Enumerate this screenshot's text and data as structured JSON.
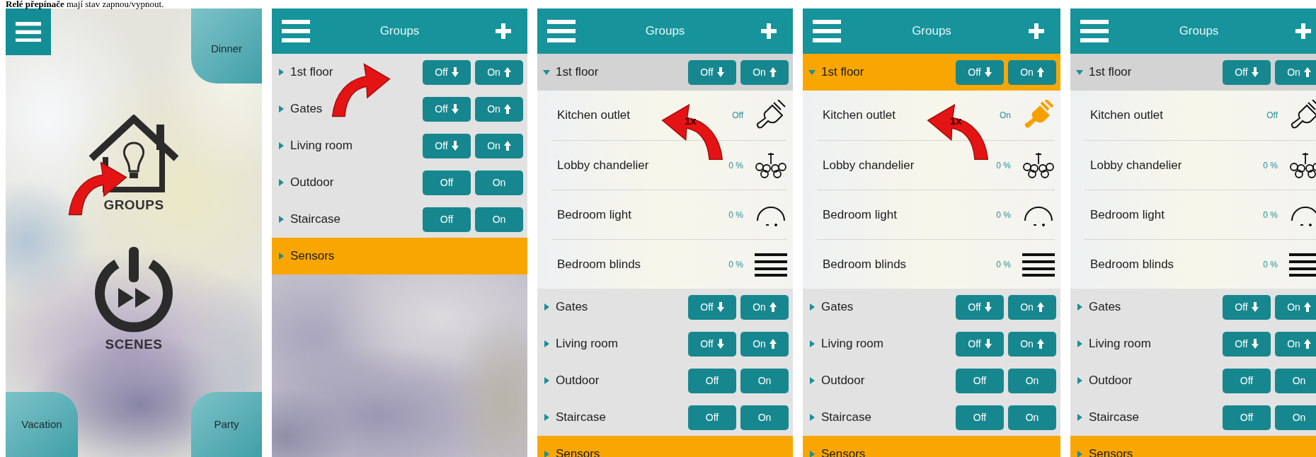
{
  "caption": "**Relé přepínače** mají stav zapnou/vypnout.",
  "home_screen": {
    "tiles": [
      {
        "label": "Dinner"
      },
      {
        "label": "Vacation"
      },
      {
        "label": "Party"
      }
    ],
    "menu_items": [
      {
        "label": "GROUPS",
        "kind": "groups"
      },
      {
        "label": "SCENES",
        "kind": "scenes"
      }
    ],
    "annotation": {
      "mirrored": false
    }
  },
  "group_screens": [
    {
      "title": "Groups",
      "annotation": {
        "mirrored": false
      },
      "groups": [
        {
          "name": "1st floor",
          "expanded": false,
          "highlighted": false,
          "buttons": [
            {
              "label": "Off",
              "with_arrow": true
            },
            {
              "label": "On",
              "with_arrow": true
            }
          ]
        },
        {
          "name": "Gates",
          "expanded": false,
          "highlighted": false,
          "buttons": [
            {
              "label": "Off",
              "with_arrow": true
            },
            {
              "label": "On",
              "with_arrow": true
            }
          ]
        },
        {
          "name": "Living room",
          "expanded": false,
          "highlighted": false,
          "buttons": [
            {
              "label": "Off",
              "with_arrow": true
            },
            {
              "label": "On",
              "with_arrow": true
            }
          ]
        },
        {
          "name": "Outdoor",
          "expanded": false,
          "highlighted": false,
          "buttons": [
            {
              "label": "Off",
              "with_arrow": false
            },
            {
              "label": "On",
              "with_arrow": false
            }
          ]
        },
        {
          "name": "Staircase",
          "expanded": false,
          "highlighted": false,
          "buttons": [
            {
              "label": "Off",
              "with_arrow": false
            },
            {
              "label": "On",
              "with_arrow": false
            }
          ]
        },
        {
          "name": "Sensors",
          "expanded": false,
          "highlighted": true
        }
      ]
    },
    {
      "title": "Groups",
      "annotation": {
        "mirrored": true,
        "text": "1x"
      },
      "groups": [
        {
          "name": "1st floor",
          "expanded": true,
          "highlighted": false,
          "buttons": [
            {
              "label": "Off",
              "with_arrow": true
            },
            {
              "label": "On",
              "with_arrow": true
            }
          ],
          "devices": [
            {
              "name": "Kitchen outlet",
              "reading": "Off",
              "kind": "outlet",
              "on": false
            },
            {
              "name": "Lobby chandelier",
              "reading": "0 %",
              "kind": "chandelier"
            },
            {
              "name": "Bedroom light",
              "reading": "0 %",
              "kind": "dimmer"
            },
            {
              "name": "Bedroom blinds",
              "reading": "0 %",
              "kind": "blinds"
            }
          ]
        },
        {
          "name": "Gates",
          "expanded": false,
          "highlighted": false,
          "buttons": [
            {
              "label": "Off",
              "with_arrow": true
            },
            {
              "label": "On",
              "with_arrow": true
            }
          ]
        },
        {
          "name": "Living room",
          "expanded": false,
          "highlighted": false,
          "buttons": [
            {
              "label": "Off",
              "with_arrow": true
            },
            {
              "label": "On",
              "with_arrow": true
            }
          ]
        },
        {
          "name": "Outdoor",
          "expanded": false,
          "highlighted": false,
          "buttons": [
            {
              "label": "Off",
              "with_arrow": false
            },
            {
              "label": "On",
              "with_arrow": false
            }
          ]
        },
        {
          "name": "Staircase",
          "expanded": false,
          "highlighted": false,
          "buttons": [
            {
              "label": "Off",
              "with_arrow": false
            },
            {
              "label": "On",
              "with_arrow": false
            }
          ]
        },
        {
          "name": "Sensors",
          "expanded": false,
          "highlighted": true
        }
      ]
    },
    {
      "title": "Groups",
      "annotation": {
        "mirrored": true,
        "text": "1x"
      },
      "groups": [
        {
          "name": "1st floor",
          "expanded": true,
          "highlighted": true,
          "buttons": [
            {
              "label": "Off",
              "with_arrow": true
            },
            {
              "label": "On",
              "with_arrow": true
            }
          ],
          "devices": [
            {
              "name": "Kitchen outlet",
              "reading": "On",
              "kind": "outlet",
              "on": true
            },
            {
              "name": "Lobby chandelier",
              "reading": "0 %",
              "kind": "chandelier"
            },
            {
              "name": "Bedroom light",
              "reading": "0 %",
              "kind": "dimmer"
            },
            {
              "name": "Bedroom blinds",
              "reading": "0 %",
              "kind": "blinds"
            }
          ]
        },
        {
          "name": "Gates",
          "expanded": false,
          "highlighted": false,
          "buttons": [
            {
              "label": "Off",
              "with_arrow": true
            },
            {
              "label": "On",
              "with_arrow": true
            }
          ]
        },
        {
          "name": "Living room",
          "expanded": false,
          "highlighted": false,
          "buttons": [
            {
              "label": "Off",
              "with_arrow": true
            },
            {
              "label": "On",
              "with_arrow": true
            }
          ]
        },
        {
          "name": "Outdoor",
          "expanded": false,
          "highlighted": false,
          "buttons": [
            {
              "label": "Off",
              "with_arrow": false
            },
            {
              "label": "On",
              "with_arrow": false
            }
          ]
        },
        {
          "name": "Staircase",
          "expanded": false,
          "highlighted": false,
          "buttons": [
            {
              "label": "Off",
              "with_arrow": false
            },
            {
              "label": "On",
              "with_arrow": false
            }
          ]
        },
        {
          "name": "Sensors",
          "expanded": false,
          "highlighted": true
        }
      ]
    },
    {
      "title": "Groups",
      "groups": [
        {
          "name": "1st floor",
          "expanded": true,
          "highlighted": false,
          "buttons": [
            {
              "label": "Off",
              "with_arrow": true
            },
            {
              "label": "On",
              "with_arrow": true
            }
          ],
          "devices": [
            {
              "name": "Kitchen outlet",
              "reading": "Off",
              "kind": "outlet",
              "on": false
            },
            {
              "name": "Lobby chandelier",
              "reading": "0 %",
              "kind": "chandelier"
            },
            {
              "name": "Bedroom light",
              "reading": "0 %",
              "kind": "dimmer"
            },
            {
              "name": "Bedroom blinds",
              "reading": "0 %",
              "kind": "blinds"
            }
          ]
        },
        {
          "name": "Gates",
          "expanded": false,
          "highlighted": false,
          "buttons": [
            {
              "label": "Off",
              "with_arrow": true
            },
            {
              "label": "On",
              "with_arrow": true
            }
          ]
        },
        {
          "name": "Living room",
          "expanded": false,
          "highlighted": false,
          "buttons": [
            {
              "label": "Off",
              "with_arrow": true
            },
            {
              "label": "On",
              "with_arrow": true
            }
          ]
        },
        {
          "name": "Outdoor",
          "expanded": false,
          "highlighted": false,
          "buttons": [
            {
              "label": "Off",
              "with_arrow": false
            },
            {
              "label": "On",
              "with_arrow": false
            }
          ]
        },
        {
          "name": "Staircase",
          "expanded": false,
          "highlighted": false,
          "buttons": [
            {
              "label": "Off",
              "with_arrow": false
            },
            {
              "label": "On",
              "with_arrow": false
            }
          ]
        },
        {
          "name": "Sensors",
          "expanded": false,
          "highlighted": true
        }
      ]
    }
  ]
}
